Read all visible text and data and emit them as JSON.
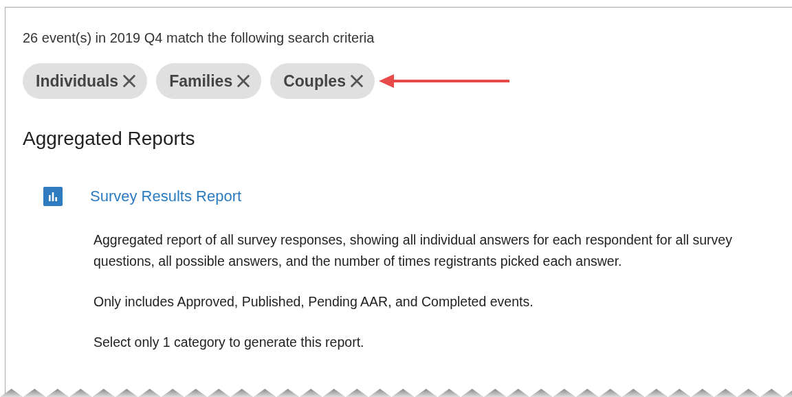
{
  "summary": "26 event(s) in 2019 Q4 match the following search criteria",
  "filters": [
    {
      "label": "Individuals"
    },
    {
      "label": "Families"
    },
    {
      "label": "Couples"
    }
  ],
  "section_title": "Aggregated Reports",
  "reports": [
    {
      "title": "Survey Results Report",
      "paragraphs": [
        "Aggregated report of all survey responses, showing all individual answers for each respondent for all survey questions, all possible answers, and the number of times registrants picked each answer.",
        "Only includes Approved, Published, Pending AAR, and Completed events.",
        "Select only 1 category to generate this report."
      ]
    }
  ]
}
